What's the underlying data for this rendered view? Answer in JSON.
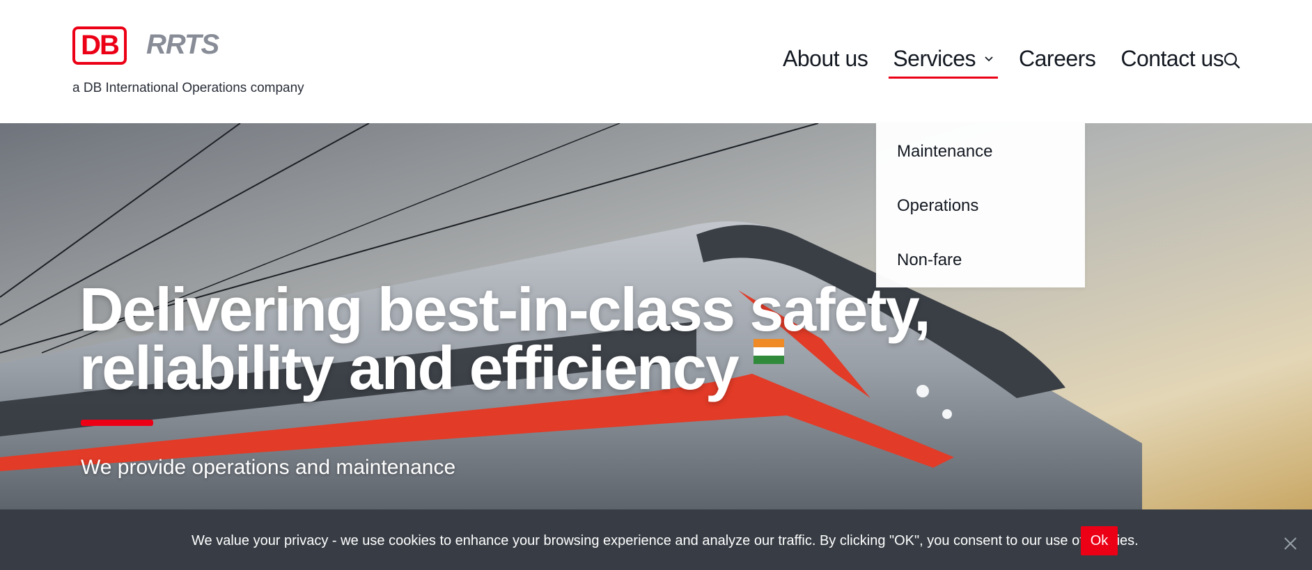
{
  "brand": {
    "logo_mark": "DB",
    "logo_name": "RRTS",
    "tagline": "a DB International Operations company",
    "accent_color": "#ec0016"
  },
  "nav": {
    "items": [
      {
        "label": "About us"
      },
      {
        "label": "Services",
        "active": true
      },
      {
        "label": "Careers"
      },
      {
        "label": "Contact us"
      }
    ],
    "search_icon": "search-icon"
  },
  "services_menu": {
    "items": [
      "Maintenance",
      "Operations",
      "Non-fare"
    ]
  },
  "hero": {
    "title_line1": "Delivering best-in-class safety,",
    "title_line2": "reliability and efficiency",
    "subtitle": "We provide operations and maintenance"
  },
  "cookie_banner": {
    "text": "We value your privacy - we use cookies to enhance your browsing experience and analyze our traffic. By clicking \"OK\", you consent to our use of cookies.",
    "ok_label": "Ok",
    "close_icon": "close-icon"
  }
}
